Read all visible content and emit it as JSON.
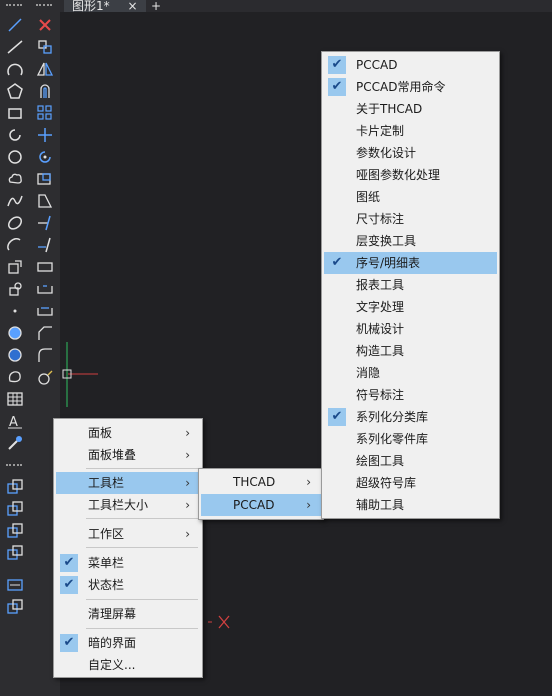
{
  "tab": {
    "title": "图形1*",
    "close": "×",
    "add": "+"
  },
  "context_menu": {
    "items": [
      {
        "label": "面板",
        "arrow": "›"
      },
      {
        "label": "面板堆叠",
        "arrow": "›"
      },
      {
        "label": "工具栏",
        "arrow": "›"
      },
      {
        "label": "工具栏大小",
        "arrow": "›"
      },
      {
        "label": "工作区",
        "arrow": "›"
      },
      {
        "label": "菜单栏",
        "check": "✔"
      },
      {
        "label": "状态栏",
        "check": "✔"
      },
      {
        "label": "清理屏幕"
      },
      {
        "label": "暗的界面",
        "check": "✔"
      },
      {
        "label": "自定义..."
      }
    ]
  },
  "toolbar_submenu": {
    "items": [
      {
        "label": "THCAD",
        "arrow": "›"
      },
      {
        "label": "PCCAD",
        "arrow": "›"
      }
    ]
  },
  "pccad_menu": {
    "items": [
      {
        "label": "PCCAD",
        "check": "✔"
      },
      {
        "label": "PCCAD常用命令",
        "check": "✔"
      },
      {
        "label": "关于THCAD"
      },
      {
        "label": "卡片定制"
      },
      {
        "label": "参数化设计"
      },
      {
        "label": "哑图参数化处理"
      },
      {
        "label": "图纸"
      },
      {
        "label": "尺寸标注"
      },
      {
        "label": "层变换工具"
      },
      {
        "label": "序号/明细表",
        "check": "✔"
      },
      {
        "label": "报表工具"
      },
      {
        "label": "文字处理"
      },
      {
        "label": "机械设计"
      },
      {
        "label": "构造工具"
      },
      {
        "label": "消隐"
      },
      {
        "label": "符号标注"
      },
      {
        "label": "系列化分类库",
        "check": "✔"
      },
      {
        "label": "系列化零件库"
      },
      {
        "label": "绘图工具"
      },
      {
        "label": "超级符号库"
      },
      {
        "label": "辅助工具"
      }
    ]
  },
  "left_tools": [
    "line-icon",
    "polyline-icon",
    "arc-icon",
    "polygon-icon",
    "rectangle-icon",
    "rotate-icon",
    "circle-icon",
    "cloud-icon",
    "spline-icon",
    "ellipse-icon",
    "ellipse-arc-icon",
    "insert-block-icon",
    "make-block-icon",
    "point-icon",
    "hatch-icon",
    "gradient-icon",
    "region-icon",
    "table-icon",
    "mtext-icon",
    "add-selected-icon"
  ],
  "right_tools": [
    "erase-icon",
    "copy-icon",
    "mirror-icon",
    "offset-icon",
    "array-icon",
    "move-icon",
    "rotate-tool-icon",
    "scale-icon",
    "stretch-icon",
    "trim-icon",
    "extend-icon",
    "break-icon",
    "break-at-point-icon",
    "join-icon",
    "chamfer-icon",
    "fillet-icon",
    "explode-icon"
  ],
  "bottom_tools": [
    "layer-icon-1",
    "layer-icon-2",
    "layer-icon-3",
    "layer-icon-4",
    "spellcheck-icon",
    "xref-icon"
  ]
}
